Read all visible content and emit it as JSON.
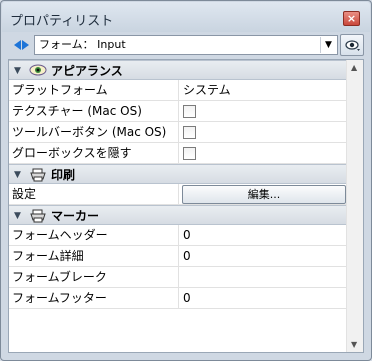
{
  "window": {
    "title": "プロパティリスト"
  },
  "toolbar": {
    "select_value": "フォーム： Input"
  },
  "sections": {
    "appearance": {
      "label": "アピアランス"
    },
    "print": {
      "label": "印刷"
    },
    "marker": {
      "label": "マーカー"
    }
  },
  "appearance_rows": [
    {
      "name": "プラットフォーム",
      "value": "システム"
    },
    {
      "name": "テクスチャー (Mac OS)",
      "checked": false
    },
    {
      "name": "ツールバーボタン (Mac OS)",
      "checked": false
    },
    {
      "name": "グローボックスを隠す",
      "checked": false
    }
  ],
  "print_rows": [
    {
      "name": "設定",
      "button_label": "編集..."
    }
  ],
  "marker_rows": [
    {
      "name": "フォームヘッダー",
      "value": "0"
    },
    {
      "name": "フォーム詳細",
      "value": "0"
    },
    {
      "name": "フォームブレーク",
      "value": ""
    },
    {
      "name": "フォームフッター",
      "value": "0"
    }
  ]
}
